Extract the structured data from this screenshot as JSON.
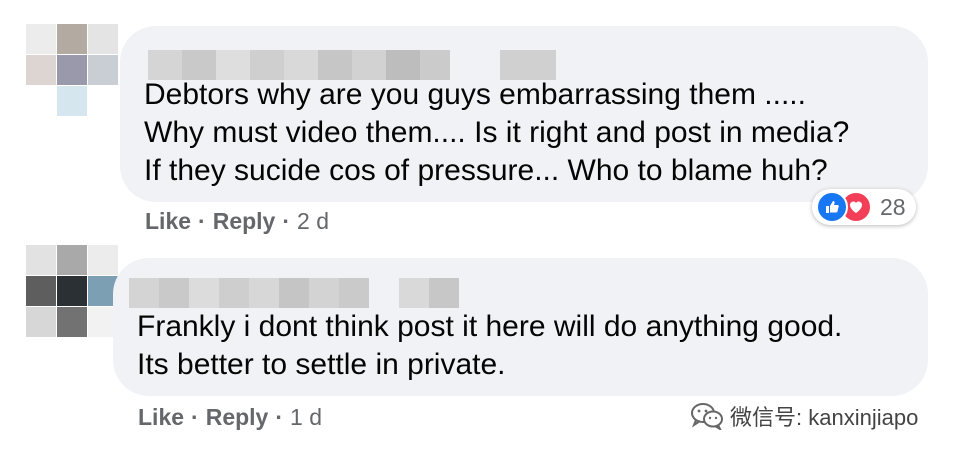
{
  "comments": [
    {
      "text_lines": [
        "Debtors why are you guys embarrassing them .....",
        "Why must video them.... Is it right and post in media?",
        "If they sucide cos of pressure... Who to blame huh?"
      ],
      "like_label": "Like",
      "separator": "·",
      "reply_label": "Reply",
      "time": "2 d",
      "reactions": {
        "icons": [
          "thumbs-up-icon",
          "heart-icon"
        ],
        "count": "28"
      }
    },
    {
      "text_lines": [
        "Frankly i dont think post it here will do anything good.",
        "Its better to settle in private."
      ],
      "like_label": "Like",
      "separator": "·",
      "reply_label": "Reply",
      "time": "1 d"
    }
  ],
  "watermark": {
    "text": "微信号: kanxinjiapo",
    "icon": "wechat-icon"
  },
  "colors": {
    "bubble": "#f0f2f5",
    "text": "#050505",
    "secondary": "#65676b",
    "like_blue": "#1877f2",
    "love_red": "#f33e58"
  }
}
